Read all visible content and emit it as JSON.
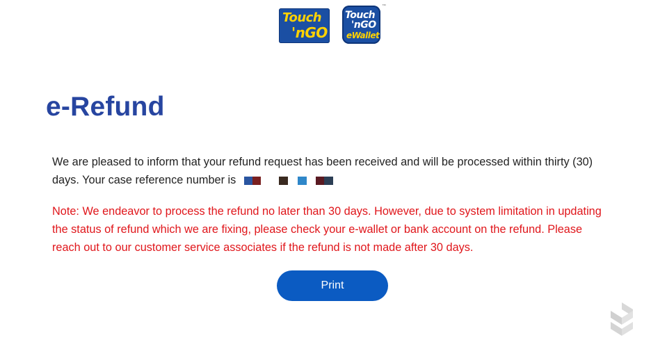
{
  "logos": {
    "tng": {
      "line1": "Touch",
      "line2": "'nGO"
    },
    "ewallet": {
      "line1": "Touch",
      "line2": "'nGO",
      "line3": "eWallet",
      "tm": "™"
    }
  },
  "page": {
    "title": "e-Refund"
  },
  "message": {
    "text": "We are pleased to inform that your refund request has been received and will be processed within thirty (30) days. Your case reference number is",
    "reference_number_redacted_colors": [
      "#2a55a0",
      "#7a2020",
      "#3a2a20",
      "#2f87c9",
      "#5a1a22",
      "#2c3e55"
    ]
  },
  "note": {
    "text": "Note: We endeavor to process the refund no later than 30 days. However, due to system limitation in updating the status of refund which we are fixing, please check your e-wallet or bank account on the refund. Please reach out to our customer service associates if the refund is not made after 30 days."
  },
  "actions": {
    "print_label": "Print"
  },
  "colors": {
    "title": "#2745a0",
    "note": "#e0161b",
    "button": "#0b5bc2",
    "logo_bg": "#1b4fa3",
    "logo_yellow": "#ffd200"
  },
  "watermark_icon": "soyacincau-logo-icon"
}
